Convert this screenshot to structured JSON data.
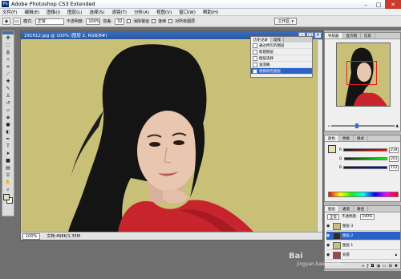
{
  "window": {
    "title": "Adobe Photoshop CS3 Extended",
    "logo": "Ps"
  },
  "menubar": [
    "文件(F)",
    "编辑(E)",
    "图像(I)",
    "图层(L)",
    "选择(S)",
    "滤镜(T)",
    "分析(A)",
    "视图(V)",
    "窗口(W)",
    "帮助(H)"
  ],
  "options": {
    "tool_preset": "▭",
    "mode_label": "模式:",
    "mode_value": "正常",
    "opacity_label": "不透明度:",
    "opacity_value": "100%",
    "flow_label": "容差:",
    "flow_value": "32",
    "antialias_label": "消除锯齿",
    "contiguous_label": "连续",
    "all_layers_label": "对所有图层",
    "workspace_label": "工作区"
  },
  "document": {
    "title": "291612.jpg @ 100% (图层 2, RGB/8#)",
    "zoom": "100%",
    "status": "文档:498K/1.35M"
  },
  "history": {
    "tabs": [
      "历史记录",
      "动作"
    ],
    "items": [
      "通过拷贝的图层",
      "新建图层",
      "图层选择",
      "油漆桶",
      "替换颜色图层"
    ],
    "selected_index": 4
  },
  "navigator": {
    "tabs": [
      "导航器",
      "直方图",
      "信息"
    ],
    "zoom": "100%"
  },
  "color": {
    "tabs": [
      "颜色",
      "色板",
      "样式"
    ],
    "channels": [
      {
        "label": "R",
        "value": "234",
        "gradient": [
          "#1a1a1a",
          "#ff0000"
        ]
      },
      {
        "label": "G",
        "value": "201",
        "gradient": [
          "#1a1a1a",
          "#00ff00"
        ]
      },
      {
        "label": "B",
        "value": "152",
        "gradient": [
          "#1a1a1a",
          "#0000ff"
        ]
      }
    ],
    "current": "#e8dfb4"
  },
  "layers": {
    "tabs": [
      "图层",
      "通道",
      "路径"
    ],
    "blend_mode": "正常",
    "opacity_label": "不透明度:",
    "opacity_value": "100%",
    "lock_label": "锁定:",
    "fill_label": "填充:",
    "fill_value": "100%",
    "items": [
      {
        "name": "图层 3",
        "selected": false,
        "thumb": "#c9c078"
      },
      {
        "name": "图层 2",
        "selected": true,
        "thumb": "#2a2a2a"
      },
      {
        "name": "图层 1",
        "selected": false,
        "thumb": "#c9c078"
      },
      {
        "name": "背景",
        "selected": false,
        "thumb": "#b04040"
      }
    ]
  },
  "watermark": {
    "main": "Bai",
    "sub": "jingyan.baidu.com"
  },
  "colors": {
    "canvas_bg": "#c9c078",
    "dress_red": "#c8242e",
    "selection_blue": "#2a62c8"
  }
}
